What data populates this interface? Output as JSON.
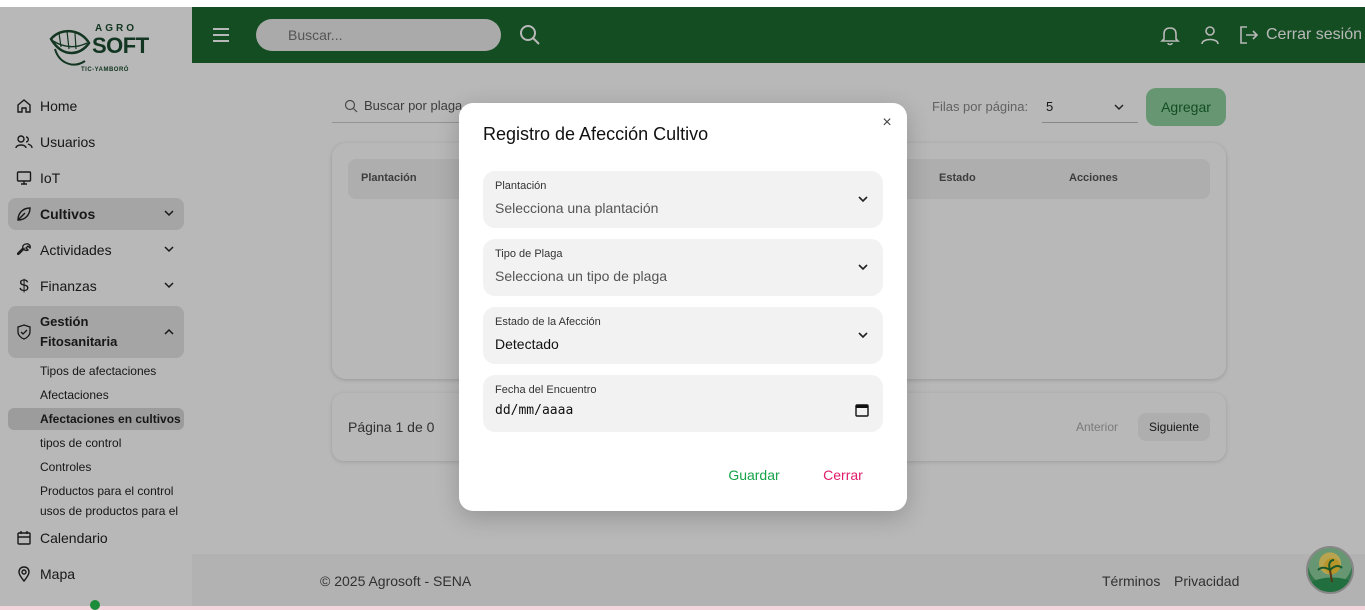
{
  "logo": {
    "line1": "AGRO",
    "line2": "SOFT",
    "line3": "TIC-YAMBORÓ"
  },
  "topbar": {
    "search_placeholder": "Buscar...",
    "logout_label": "Cerrar sesión",
    "color": "#1b6b2f"
  },
  "sidebar": {
    "items": [
      {
        "label": "Home",
        "icon": "home-icon"
      },
      {
        "label": "Usuarios",
        "icon": "users-icon"
      },
      {
        "label": "IoT",
        "icon": "monitor-icon"
      },
      {
        "label": "Cultivos",
        "icon": "leaf-icon"
      },
      {
        "label": "Actividades",
        "icon": "wrench-icon"
      },
      {
        "label": "Finanzas",
        "icon": "dollar-icon"
      },
      {
        "label": "Gestión Fitosanitaria",
        "icon": "shield-icon"
      },
      {
        "label": "Calendario",
        "icon": "calendar-icon"
      },
      {
        "label": "Mapa",
        "icon": "map-pin-icon"
      }
    ],
    "subitems": [
      "Tipos de afectaciones",
      "Afectaciones",
      "Afectaciones en cultivos",
      "tipos de control",
      "Controles",
      "Productos para el control",
      "usos de productos para el"
    ]
  },
  "table": {
    "search_placeholder": "Buscar por plaga",
    "rows_label": "Filas por página:",
    "rows_value": "5",
    "add_label": "Agregar",
    "columns": [
      "Plantación",
      "Estado",
      "Acciones"
    ],
    "pager_text": "Página 1 de 0",
    "prev_label": "Anterior",
    "next_label": "Siguiente"
  },
  "modal": {
    "title": "Registro de Afección Cultivo",
    "close_symbol": "×",
    "fields": [
      {
        "label": "Plantación",
        "value": "Selecciona una plantación"
      },
      {
        "label": "Tipo de Plaga",
        "value": "Selecciona un tipo de plaga"
      },
      {
        "label": "Estado de la Afección",
        "value": "Detectado"
      },
      {
        "label": "Fecha del Encuentro",
        "value": "dd/mm/aaaa"
      }
    ],
    "save_label": "Guardar",
    "cancel_label": "Cerrar"
  },
  "footer": {
    "copyright": "© 2025 Agrosoft - SENA",
    "terms": "Términos",
    "privacy": "Privacidad"
  }
}
